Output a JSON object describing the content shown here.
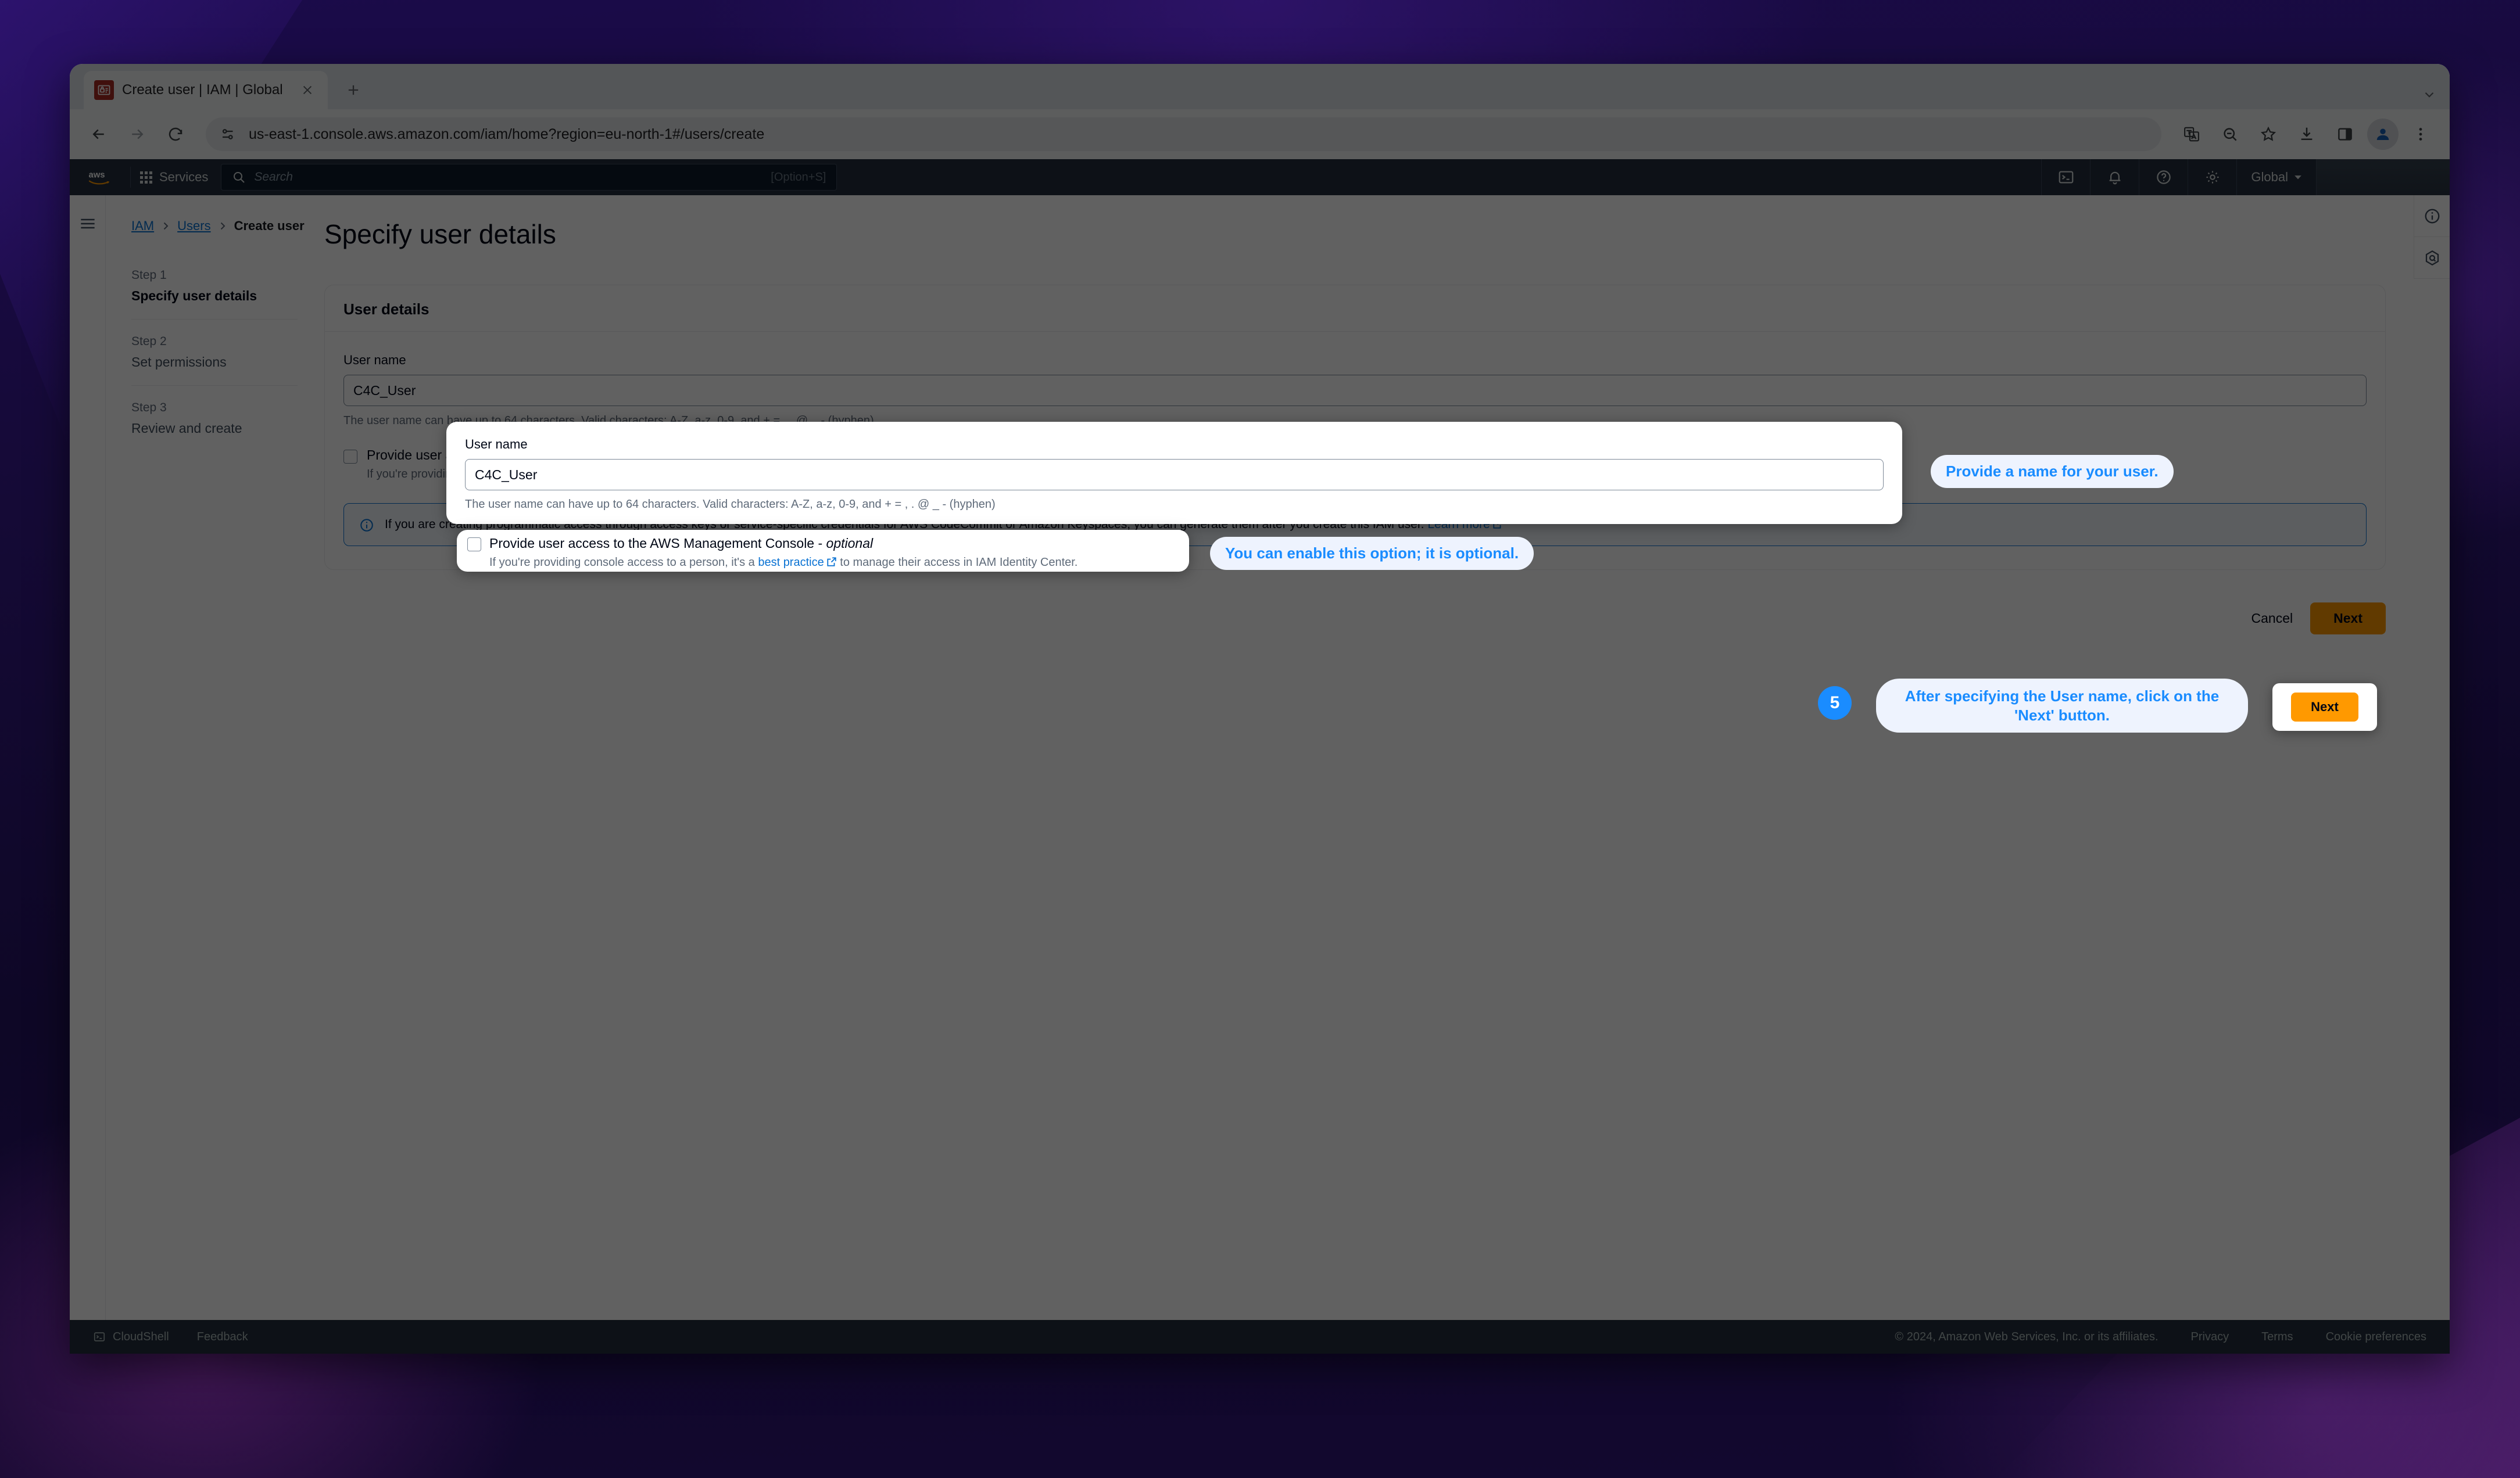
{
  "browser": {
    "tab": {
      "title": "Create user | IAM | Global",
      "favicon": "iam-lock-icon"
    },
    "new_tab_label": "+",
    "url": "us-east-1.console.aws.amazon.com/iam/home?region=eu-north-1#/users/create",
    "nav_icons": [
      "back-icon",
      "forward-icon",
      "reload-icon",
      "site-settings-icon"
    ],
    "toolbar_icons": [
      "translate-icon",
      "zoom-out-icon",
      "bookmark-star-icon",
      "download-icon",
      "side-panel-icon",
      "profile-avatar-icon",
      "chrome-menu-icon"
    ]
  },
  "aws_nav": {
    "logo": "aws-logo",
    "services_label": "Services",
    "search_placeholder": "Search",
    "search_shortcut": "[Option+S]",
    "icons": [
      "cloudshell-icon",
      "notifications-bell-icon",
      "help-question-icon",
      "settings-gear-icon"
    ],
    "region_label": "Global"
  },
  "breadcrumb": {
    "items": [
      {
        "label": "IAM",
        "link": true
      },
      {
        "label": "Users",
        "link": true
      },
      {
        "label": "Create user",
        "link": false
      }
    ]
  },
  "steps": [
    {
      "num": "Step 1",
      "name": "Specify user details",
      "active": true
    },
    {
      "num": "Step 2",
      "name": "Set permissions",
      "active": false
    },
    {
      "num": "Step 3",
      "name": "Review and create",
      "active": false
    }
  ],
  "main": {
    "page_title": "Specify user details",
    "card_title": "User details",
    "user_name": {
      "label": "User name",
      "value": "C4C_User",
      "placeholder": "",
      "help": "The user name can have up to 64 characters. Valid characters: A-Z, a-z, 0-9, and + = , . @ _ - (hyphen)"
    },
    "console_access": {
      "checked": false,
      "label_main": "Provide user access to the AWS Management Console - ",
      "label_optional": "optional",
      "desc_before": "If you're providing console access to a person, it's a ",
      "desc_link": "best practice",
      "desc_after": " to manage their access in IAM Identity Center."
    },
    "alert": {
      "icon": "info-circle-icon",
      "text": "If you are creating programmatic access through access keys or service-specific credentials for AWS CodeCommit or Amazon Keyspaces, you can generate them after you create this IAM user. ",
      "link": "Learn more"
    },
    "actions": {
      "cancel": "Cancel",
      "next": "Next"
    }
  },
  "right_rail": {
    "icons": [
      "info-circle-icon",
      "amazon-q-icon"
    ]
  },
  "footer": {
    "cloudshell": "CloudShell",
    "feedback": "Feedback",
    "copyright": "© 2024, Amazon Web Services, Inc. or its affiliates.",
    "privacy": "Privacy",
    "terms": "Terms",
    "cookies": "Cookie preferences"
  },
  "callouts": {
    "name_tip": "Provide a name for your user.",
    "optional_tip": "You can enable this option; it is optional.",
    "next_tip": "After specifying the User name, click on the 'Next' button.",
    "step_badge": "5",
    "accent": "#1a8cff",
    "bubble_bg": "#eef3fe"
  }
}
